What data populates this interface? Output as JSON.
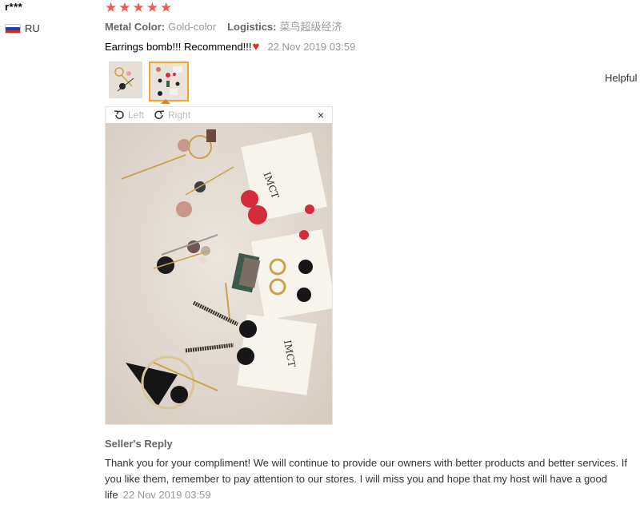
{
  "review": {
    "username": "r***",
    "country": "RU",
    "rating": 5,
    "stars": [
      "★",
      "★",
      "★",
      "★",
      "★"
    ],
    "metal_color_label": "Metal Color:",
    "metal_color_value": "Gold-color",
    "logistics_label": "Logistics:",
    "logistics_value": "菜鸟超级经济",
    "text": "Earrings bomb!!! Recommend!!!",
    "emoji": "♥",
    "date": "22 Nov 2019 03:59",
    "helpful_label": "Helpful"
  },
  "viewer": {
    "rotate_left_label": "Left",
    "rotate_right_label": "Right",
    "close_label": "×"
  },
  "seller": {
    "title": "Seller's Reply",
    "text": "Thank you for your compliment! We will continue to provide our owners with better products and better services. If you like them, remember to pay attention to our stores. I will miss you and hope that my host will have a good life",
    "date": "22 Nov 2019 03:59"
  },
  "colors": {
    "star": "#f25a4f",
    "heart": "#e02a2a",
    "active_border": "#f5a623",
    "pointer": "#f07a22"
  }
}
